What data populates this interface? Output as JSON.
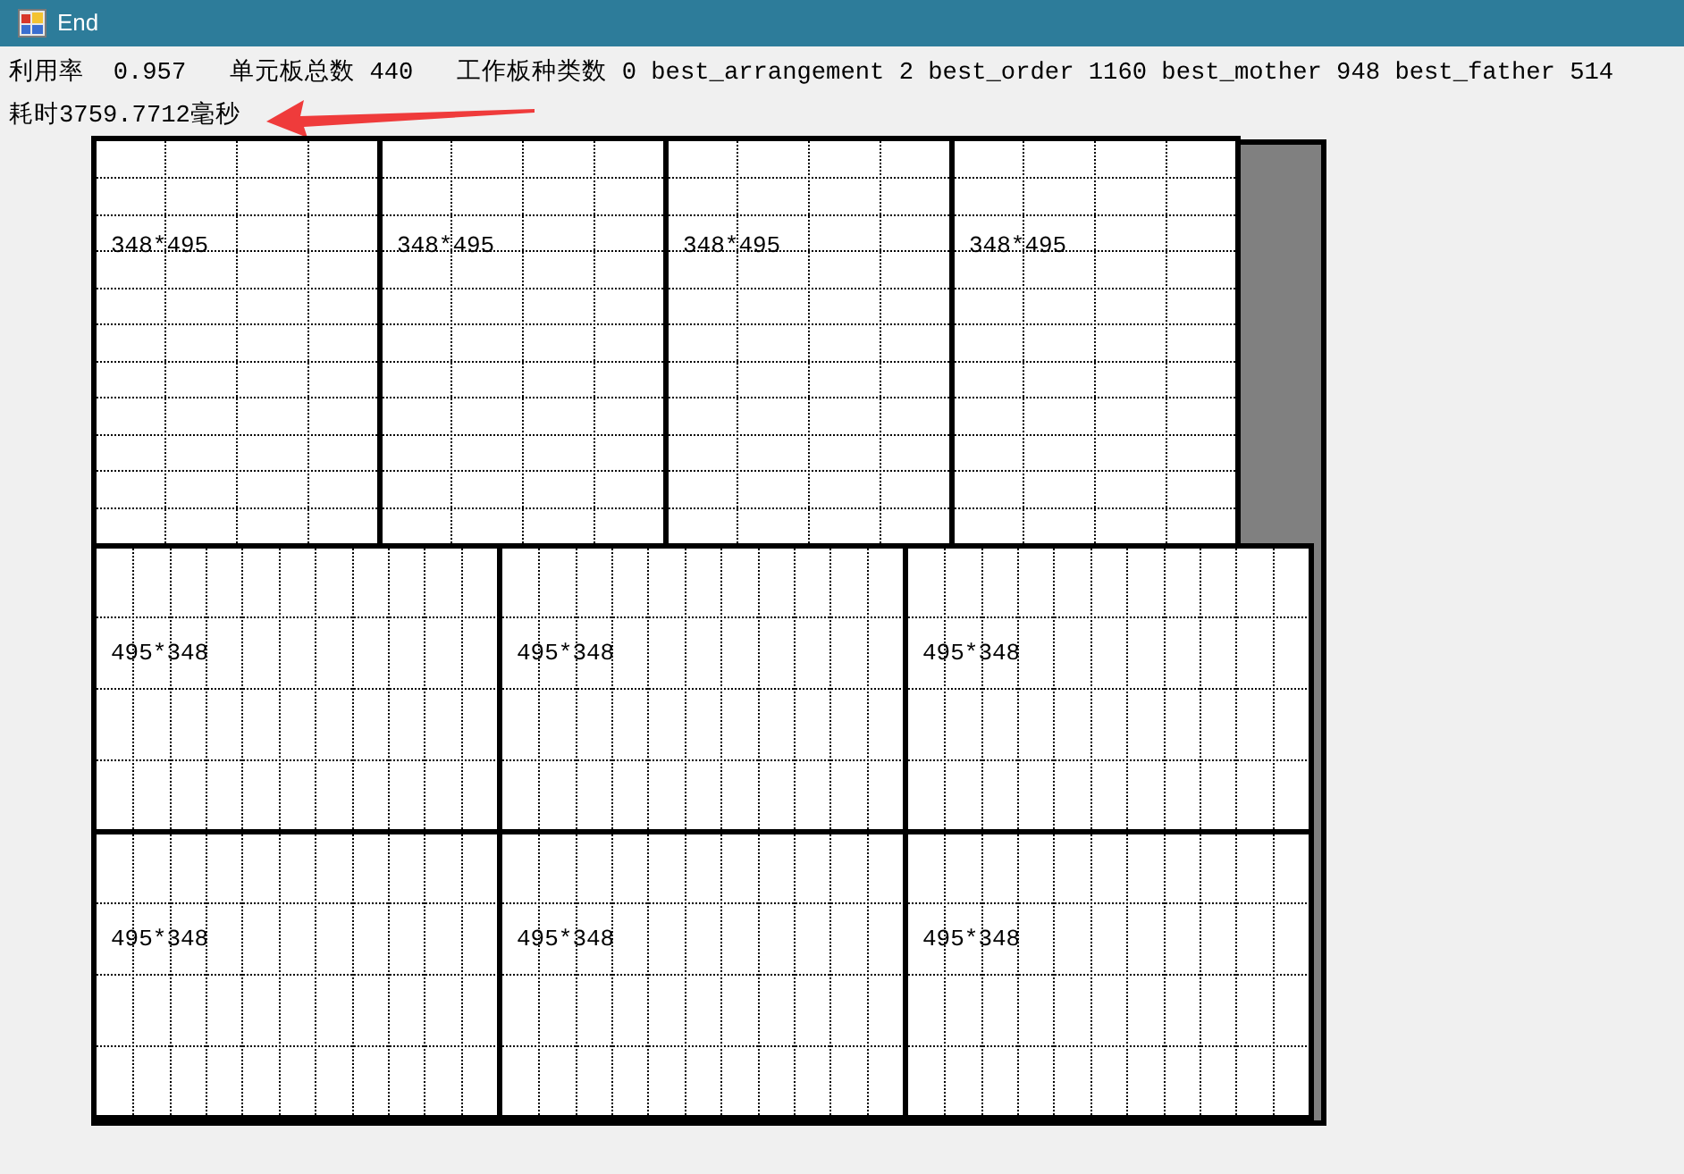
{
  "window": {
    "title": "End"
  },
  "stats_line": "利用率  0.957   单元板总数 440   工作板种类数 0 best_arrangement 2 best_order 1160 best_mother 948 best_father 514",
  "elapsed": "耗时3759.7712毫秒",
  "board": {
    "rows": [
      {
        "pieces": [
          {
            "label": "348*495",
            "kind": "portrait"
          },
          {
            "label": "348*495",
            "kind": "portrait"
          },
          {
            "label": "348*495",
            "kind": "portrait"
          },
          {
            "label": "348*495",
            "kind": "portrait"
          }
        ]
      },
      {
        "pieces": [
          {
            "label": "495*348",
            "kind": "landscape"
          },
          {
            "label": "495*348",
            "kind": "landscape"
          },
          {
            "label": "495*348",
            "kind": "landscape"
          }
        ]
      },
      {
        "pieces": [
          {
            "label": "495*348",
            "kind": "landscape"
          },
          {
            "label": "495*348",
            "kind": "landscape"
          },
          {
            "label": "495*348",
            "kind": "landscape"
          }
        ]
      }
    ]
  }
}
